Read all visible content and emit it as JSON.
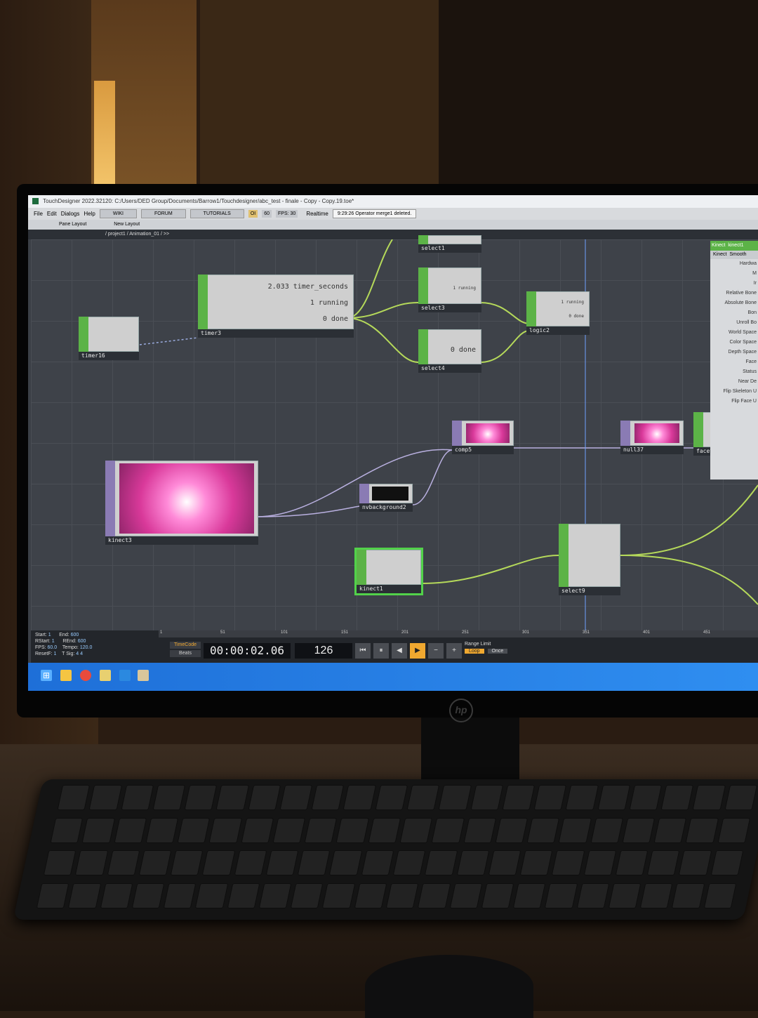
{
  "window": {
    "title": "TouchDesigner 2022.32120: C:/Users/DED Group/Documents/Barrow1/Touchdesigner/abc_test - finale - Copy - Copy.19.toe*"
  },
  "menu": {
    "items": [
      "File",
      "Edit",
      "Dialogs",
      "Help"
    ],
    "buttons": [
      "WIKI",
      "FORUM",
      "TUTORIALS"
    ],
    "oi": "OI",
    "fps_target": "60",
    "fps_label": "FPS: 30",
    "realtime": "Realtime",
    "status": "9:29:26 Operator merge1 deleted."
  },
  "pane": {
    "layout_label": "Pane Layout",
    "new_layout": "New Layout"
  },
  "path": "/ project1 / Animation_01 / >>",
  "operators": {
    "timer16": "timer16",
    "timer3": "timer3",
    "timer3_seconds": "2.033 timer_seconds",
    "timer3_running": "1 running",
    "timer3_done": "0 done",
    "select1": "select1",
    "select3": "select3",
    "select3_val": "1 running",
    "select4": "select4",
    "select4_val": "0 done",
    "logic2": "logic2",
    "logic2_running": "1 running",
    "logic2_done": "0 done",
    "comp5": "comp5",
    "null37": "null37",
    "facetrack": "facetrack",
    "kinect3": "kinect3",
    "nvbackground2": "nvbackground2",
    "kinect1": "kinect1",
    "select9": "select9"
  },
  "params_panel": {
    "header": "Kinect",
    "op_name": "kinect1",
    "tabs": [
      "Kinect",
      "Smooth"
    ],
    "rows": [
      "Hardwa",
      "M",
      "Ir",
      "Relative Bone",
      "Absolute Bone",
      "Bon",
      "Unroll Bo",
      "World Space",
      "Color Space",
      "Depth Space",
      "Face",
      "Status",
      "Near De",
      "Flip Skeleton U",
      "Flip Face U"
    ]
  },
  "timeline": {
    "start": "1",
    "end": "600",
    "rstart": "1",
    "rend": "600",
    "fps": "60.0",
    "tempo": "120.0",
    "resetf": "1",
    "tsig_a": "4",
    "tsig_b": "4",
    "labels": {
      "start": "Start:",
      "end": "End:",
      "rstart": "RStart:",
      "rend": "REnd:",
      "fps": "FPS:",
      "tempo": "Tempo:",
      "resetf": "ResetF:",
      "tsig": "T Sig:"
    },
    "ruler": [
      "1",
      "51",
      "101",
      "151",
      "201",
      "251",
      "301",
      "351",
      "401",
      "451"
    ],
    "timecode_label": "TimeCode",
    "beats_label": "Beats",
    "time": "00:00:02.06",
    "frame": "126",
    "range_limit": "Range Limit",
    "loop": "Loop",
    "once": "Once"
  },
  "monitor_logo": "hp"
}
